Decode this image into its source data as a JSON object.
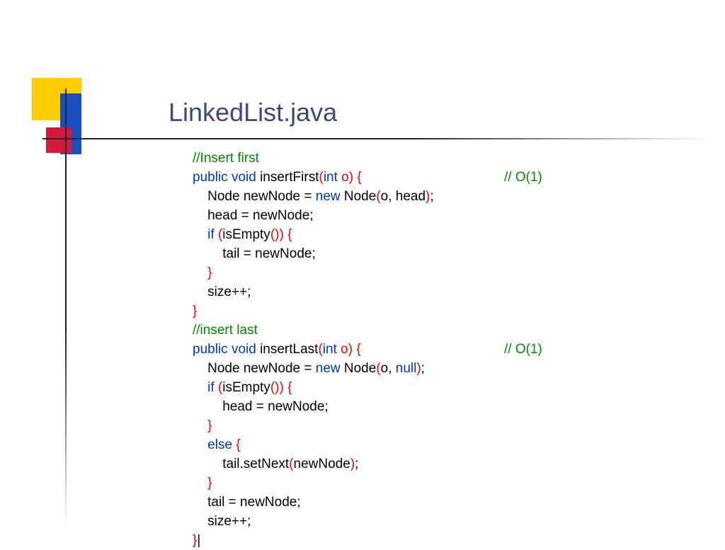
{
  "title": "LinkedList.java",
  "c": {
    "cmt1": "//Insert first",
    "kw_public": "public",
    "kw_void": "void",
    "m_insertFirst": " insertFirst",
    "p_lp": "(",
    "kw_int": "int",
    "p_o_rp": " o)",
    "p_sp_lb": " {",
    "cx_o1": "// O(1)",
    "l3a": "    Node newNode = ",
    "kw_new": "new",
    "l3b": " Node",
    "l3c": "(",
    "l3d": "o, head",
    "l3e": ")",
    "l3f": ";",
    "l4": "    head = newNode;",
    "kw_if": "if",
    "l5a": "    ",
    "l5b": " (",
    "l5c": "isEmpty",
    "l5d": "())",
    "l5e": " {",
    "l6": "        tail = newNode;",
    "l7": "    }",
    "l8": "    size++;",
    "l9": "}",
    "cmt2": "//insert last",
    "m_insertLast": " insertLast",
    "l13d": "o, ",
    "kw_null": "null",
    "l16": "        head = newNode;",
    "kw_else": "else",
    "l18a": "    ",
    "l18b": " {",
    "l19a": "        tail.setNext",
    "l19b": "(",
    "l19c": "newNode",
    "l19d": ")",
    "l19e": ";",
    "l21": "    tail = newNode;",
    "l22": "    size++;",
    "l23": "}",
    "cursor": "|"
  }
}
